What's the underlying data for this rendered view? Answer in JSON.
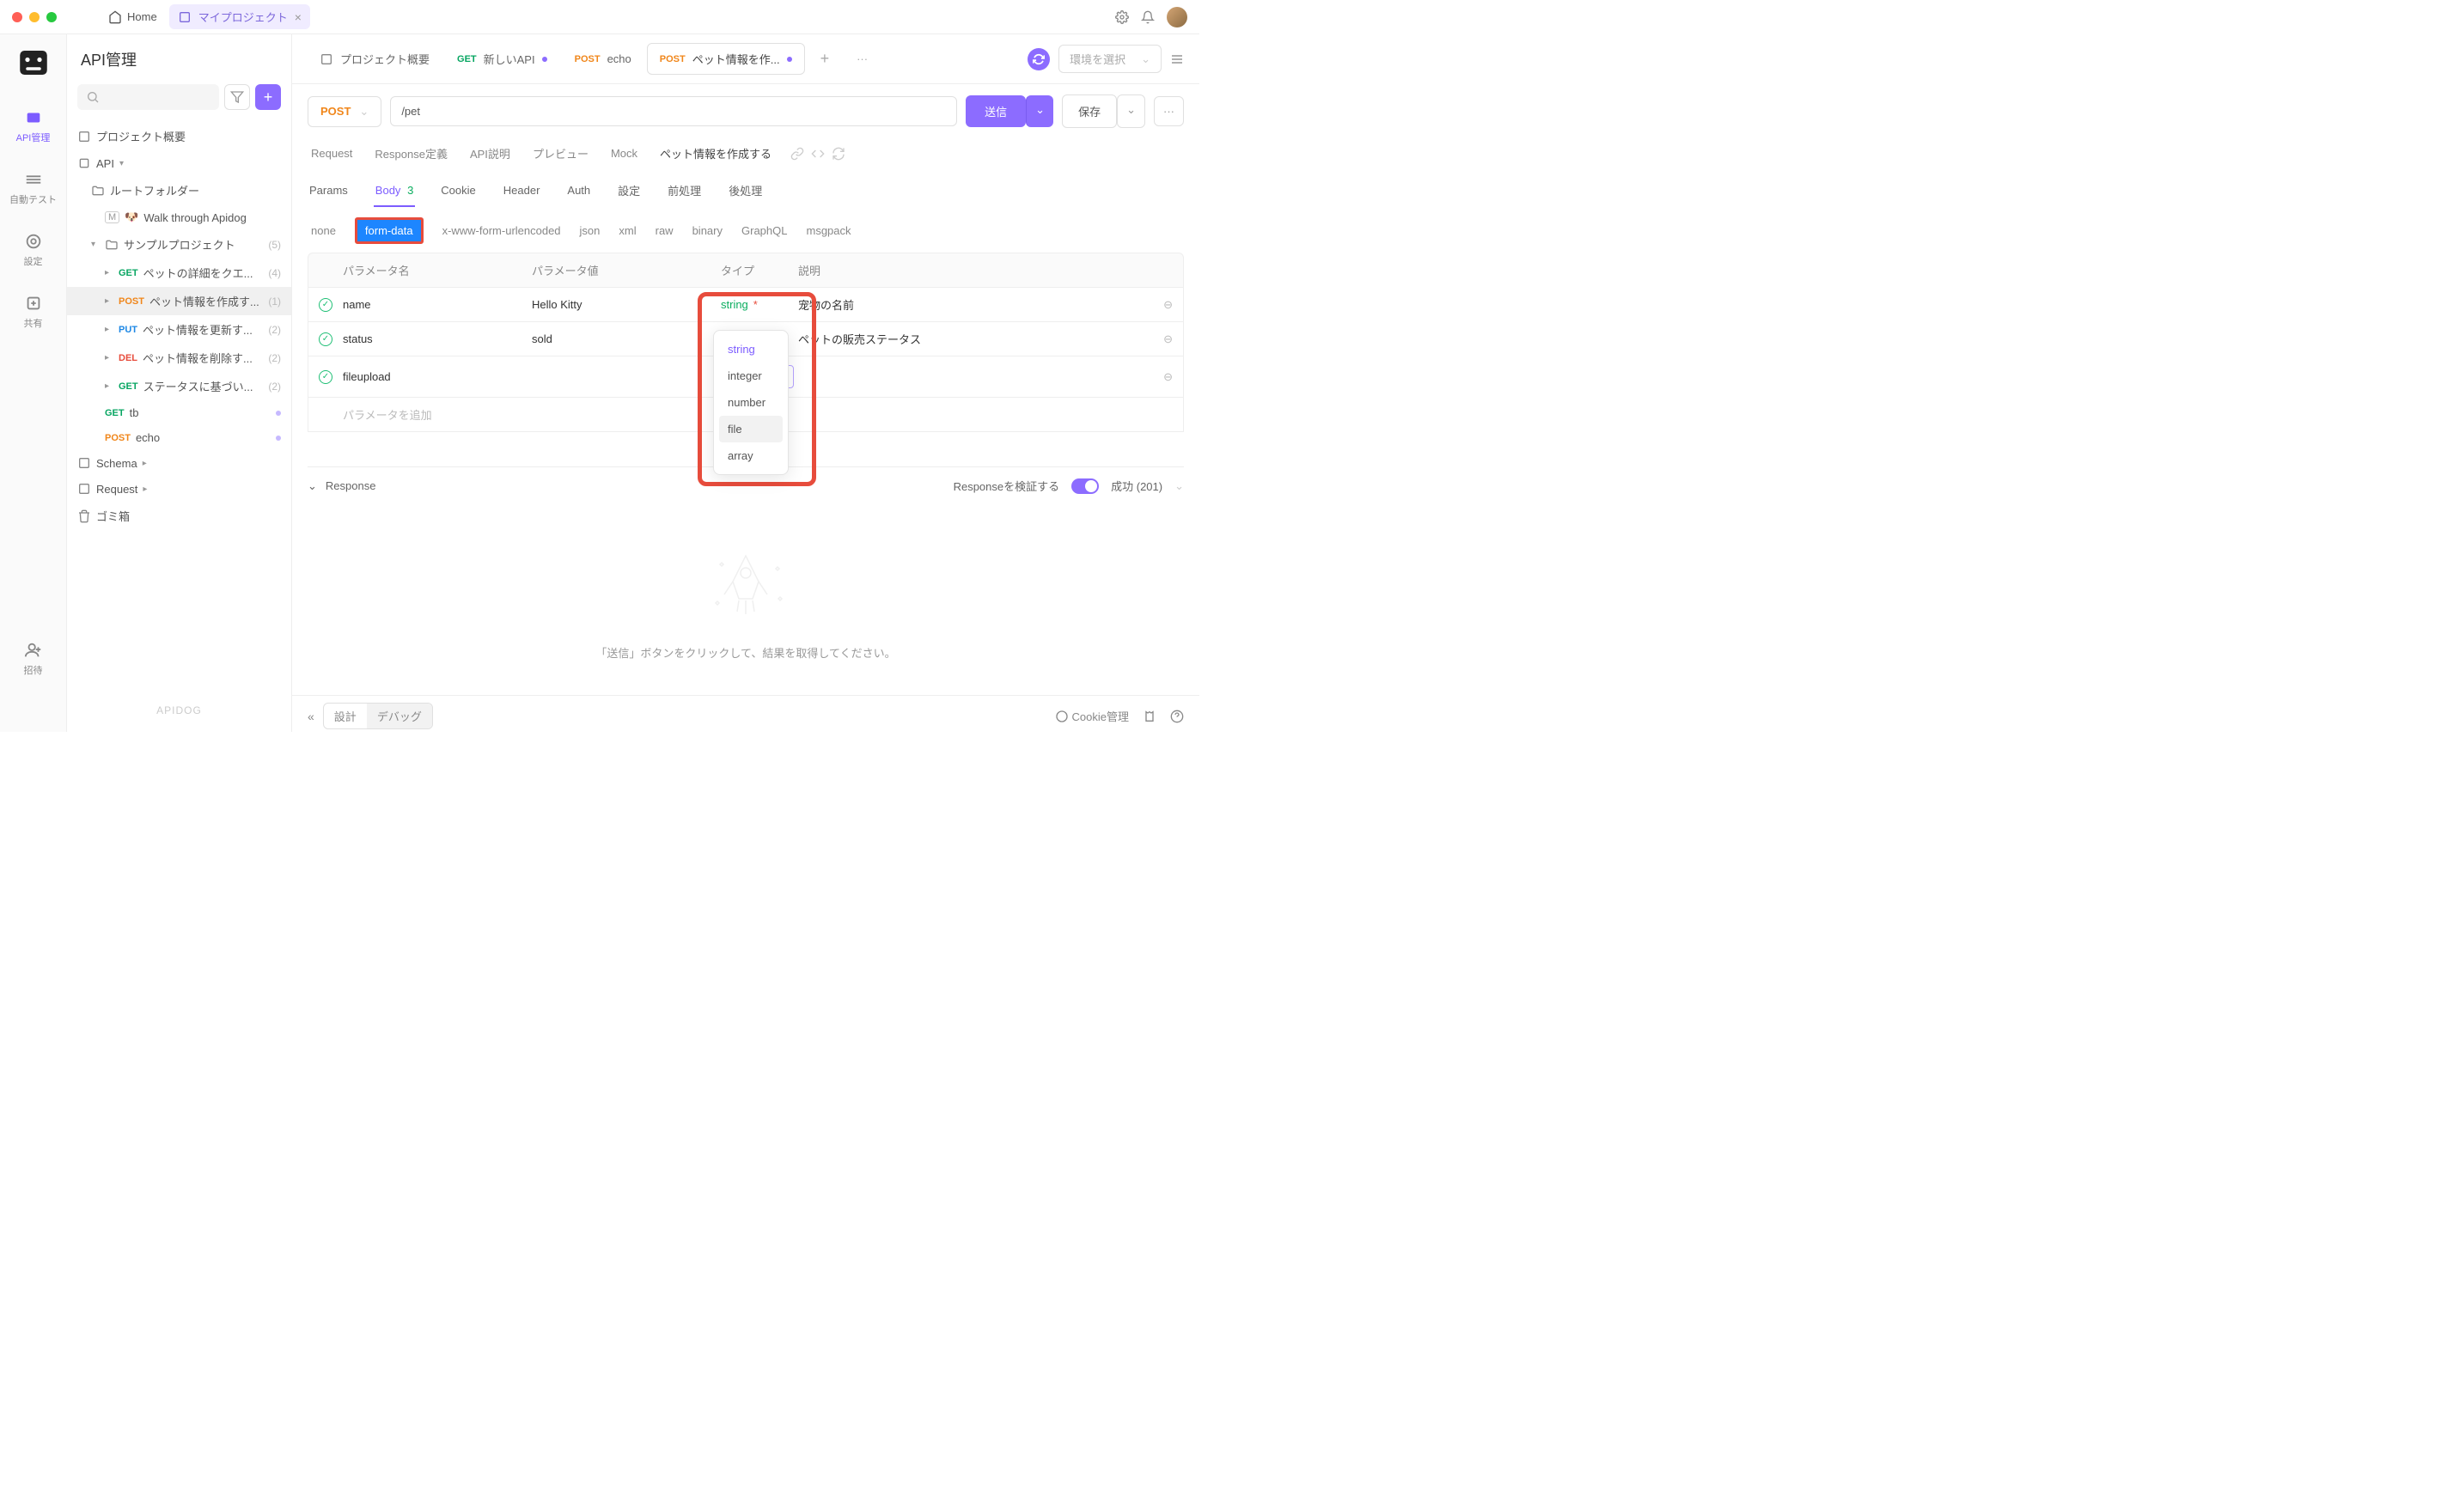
{
  "titlebar": {
    "home_label": "Home",
    "project_tab": "マイプロジェクト"
  },
  "rail": {
    "items": [
      {
        "label": "API管理"
      },
      {
        "label": "自動テスト"
      },
      {
        "label": "設定"
      },
      {
        "label": "共有"
      },
      {
        "label": "招待"
      }
    ]
  },
  "sidebar": {
    "title": "API管理",
    "project_overview": "プロジェクト概要",
    "api_section": "API",
    "root_folder": "ルートフォルダー",
    "walk_item": "Walk through Apidog",
    "sample_project": "サンプルプロジェクト",
    "sample_count": "(5)",
    "apis": [
      {
        "method": "GET",
        "label": "ペットの詳細をクエ...",
        "count": "(4)"
      },
      {
        "method": "POST",
        "label": "ペット情報を作成す...",
        "count": "(1)"
      },
      {
        "method": "PUT",
        "label": "ペット情報を更新す...",
        "count": "(2)"
      },
      {
        "method": "DEL",
        "label": "ペット情報を削除す...",
        "count": "(2)"
      },
      {
        "method": "GET",
        "label": "ステータスに基づい...",
        "count": "(2)"
      }
    ],
    "tb": "tb",
    "echo": "echo",
    "schema": "Schema",
    "request": "Request",
    "trash": "ゴミ箱",
    "footer": "APIDOG"
  },
  "tabs": {
    "overview": "プロジェクト概要",
    "new_api": "新しいAPI",
    "echo": "echo",
    "current": "ペット情報を作..."
  },
  "env": {
    "placeholder": "環境を選択"
  },
  "url": {
    "method": "POST",
    "path": "/pet",
    "send": "送信",
    "save": "保存"
  },
  "doc_tabs": {
    "request": "Request",
    "response_def": "Response定義",
    "api_desc": "API説明",
    "preview": "プレビュー",
    "mock": "Mock",
    "title": "ペット情報を作成する"
  },
  "param_tabs": {
    "params": "Params",
    "body": "Body",
    "body_count": "3",
    "cookie": "Cookie",
    "header": "Header",
    "auth": "Auth",
    "settings": "設定",
    "pre": "前処理",
    "post": "後処理"
  },
  "body_types": {
    "none": "none",
    "form_data": "form-data",
    "urlencoded": "x-www-form-urlencoded",
    "json": "json",
    "xml": "xml",
    "raw": "raw",
    "binary": "binary",
    "graphql": "GraphQL",
    "msgpack": "msgpack"
  },
  "ptable": {
    "head_name": "パラメータ名",
    "head_value": "パラメータ値",
    "head_type": "タイプ",
    "head_desc": "説明",
    "rows": [
      {
        "name": "name",
        "value": "Hello Kitty",
        "type": "string",
        "required": true,
        "desc": "宠物の名前"
      },
      {
        "name": "status",
        "value": "sold",
        "type": "string",
        "required": true,
        "desc": "ペットの販売ステータス"
      },
      {
        "name": "fileupload",
        "value": "",
        "type": "",
        "required": false,
        "desc": ""
      }
    ],
    "add_placeholder": "パラメータを追加",
    "type_placeholder": "string"
  },
  "dropdown": {
    "options": [
      "string",
      "integer",
      "number",
      "file",
      "array"
    ]
  },
  "response": {
    "title": "Response",
    "verify_label": "Responseを検証する",
    "status": "成功 (201)",
    "placeholder": "「送信」ボタンをクリックして、結果を取得してください。"
  },
  "bottom": {
    "design": "設計",
    "debug": "デバッグ",
    "cookie": "Cookie管理"
  }
}
